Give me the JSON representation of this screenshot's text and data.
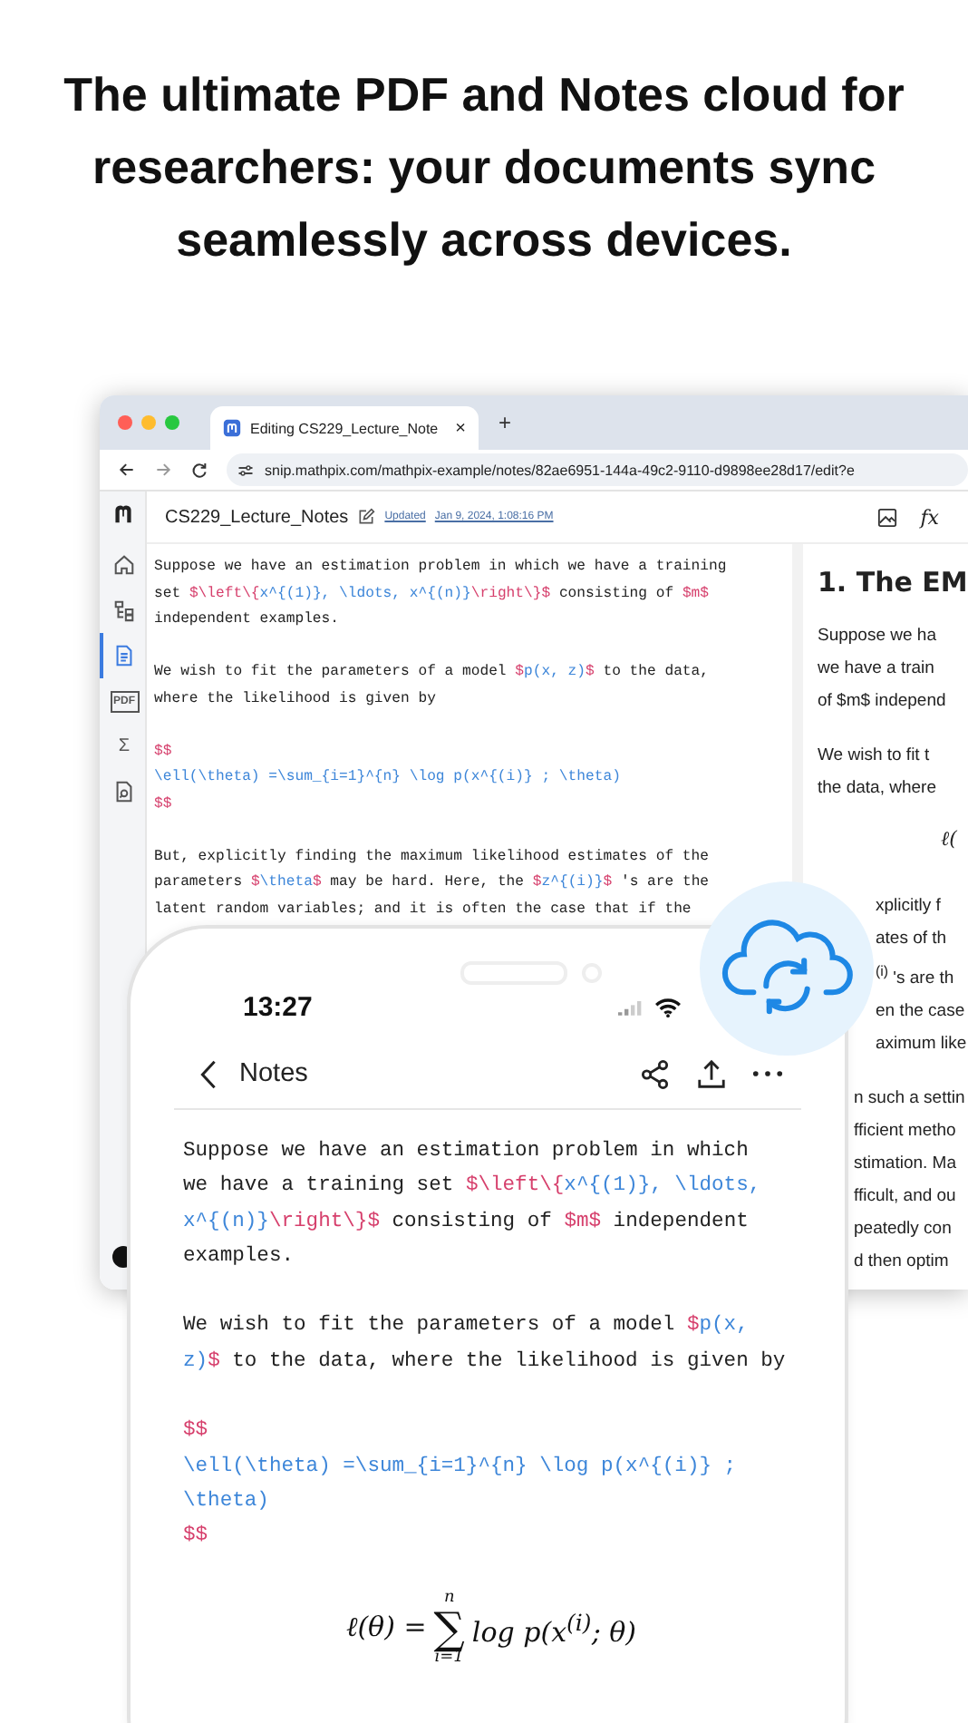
{
  "headline": "The ultimate PDF and Notes cloud for researchers: your documents sync seamlessly across devices.",
  "browser": {
    "tab_title": "Editing CS229_Lecture_Note",
    "tab_close": "×",
    "new_tab": "+",
    "url": "snip.mathpix.com/mathpix-example/notes/82ae6951-144a-49c2-9110-d9898ee28d17/edit?e",
    "note_title": "CS229_Lecture_Notes",
    "updated_label": "Updated",
    "updated_date": "Jan 9, 2024, 1:08:16 PM",
    "formula_button": "fx",
    "sidebar": [
      {
        "kind": "home",
        "selected": false
      },
      {
        "kind": "outline",
        "selected": false
      },
      {
        "kind": "document",
        "selected": true
      },
      {
        "kind": "pdf",
        "label": "PDF",
        "selected": false
      },
      {
        "kind": "sigma",
        "label": "Σ",
        "selected": false
      },
      {
        "kind": "search-doc",
        "selected": false
      }
    ],
    "editor": [
      [
        [
          {
            "text": "Suppose we have an estimation problem in which we have a training",
            "kind": "plain"
          }
        ],
        [
          {
            "text": "set ",
            "kind": "plain"
          },
          {
            "text": "$\\left\\{",
            "kind": "delim"
          },
          {
            "text": "x^{(1)}, \\ldots, x^{(n)}",
            "kind": "math"
          },
          {
            "text": "\\right\\}$",
            "kind": "delim"
          },
          {
            "text": " consisting of ",
            "kind": "plain"
          },
          {
            "text": "$m$",
            "kind": "delim"
          }
        ],
        [
          {
            "text": "independent examples.",
            "kind": "plain"
          }
        ]
      ],
      [
        [
          {
            "text": "We wish to fit the parameters of a model ",
            "kind": "plain"
          },
          {
            "text": "$",
            "kind": "delim"
          },
          {
            "text": "p(x, z)",
            "kind": "math"
          },
          {
            "text": "$",
            "kind": "delim"
          },
          {
            "text": " to the data,",
            "kind": "plain"
          }
        ],
        [
          {
            "text": "where the likelihood is given by",
            "kind": "plain"
          }
        ]
      ],
      [
        [
          {
            "text": "$$",
            "kind": "delim"
          }
        ],
        [
          {
            "text": "\\ell(\\theta) =\\sum_{i=1}^{n} \\log p(x^{(i)} ; \\theta)",
            "kind": "math"
          }
        ],
        [
          {
            "text": "$$",
            "kind": "delim"
          }
        ]
      ],
      [
        [
          {
            "text": "But, explicitly finding the maximum likelihood estimates of the",
            "kind": "plain"
          }
        ],
        [
          {
            "text": "parameters ",
            "kind": "plain"
          },
          {
            "text": "$",
            "kind": "delim"
          },
          {
            "text": "\\theta",
            "kind": "math"
          },
          {
            "text": "$",
            "kind": "delim"
          },
          {
            "text": " may be hard. Here, the ",
            "kind": "plain"
          },
          {
            "text": "$",
            "kind": "delim"
          },
          {
            "text": "z^{(i)}",
            "kind": "math"
          },
          {
            "text": "$",
            "kind": "delim"
          },
          {
            "text": " 's are the",
            "kind": "plain"
          }
        ],
        [
          {
            "text": "latent random variables; and it is often the case that if the",
            "kind": "plain"
          }
        ]
      ]
    ],
    "preview": {
      "heading": "1. The EM",
      "paragraphs": [
        [
          "Suppose we ha",
          "we have a train",
          "of $m$ independ"
        ],
        [
          "We wish to fit t",
          "the data, where"
        ]
      ],
      "formula_fragment": "ℓ(",
      "cut_paragraphs": [
        [
          "xplicitly f",
          "ates of th",
          "$^{(i)}$ 's are th",
          "en the case",
          "aximum like"
        ],
        [
          "n such a settin",
          "fficient metho",
          "stimation. Ma",
          "fficult, and ou",
          "peatedly con",
          "d then optim"
        ]
      ]
    }
  },
  "phone": {
    "time": "13:27",
    "back_label": "Notes",
    "paragraphs": [
      [
        [
          {
            "text": "Suppose we have an estimation problem in which",
            "kind": "plain"
          }
        ],
        [
          {
            "text": "we have a training set ",
            "kind": "plain"
          },
          {
            "text": "$\\left\\{",
            "kind": "delim"
          },
          {
            "text": "x^{(1)}, \\ldots,",
            "kind": "math"
          }
        ],
        [
          {
            "text": "x^{(n)}",
            "kind": "math"
          },
          {
            "text": "\\right\\}$",
            "kind": "delim"
          },
          {
            "text": " consisting of ",
            "kind": "plain"
          },
          {
            "text": "$m$",
            "kind": "delim"
          },
          {
            "text": " independent",
            "kind": "plain"
          }
        ],
        [
          {
            "text": "examples.",
            "kind": "plain"
          }
        ]
      ],
      [
        [
          {
            "text": "We wish to fit the parameters of a model ",
            "kind": "plain"
          },
          {
            "text": "$",
            "kind": "delim"
          },
          {
            "text": "p(x,",
            "kind": "math"
          }
        ],
        [
          {
            "text": "z)",
            "kind": "math"
          },
          {
            "text": "$",
            "kind": "delim"
          },
          {
            "text": " to the data, where the likelihood is given by",
            "kind": "plain"
          }
        ]
      ],
      [
        [
          {
            "text": "$$",
            "kind": "delim"
          }
        ],
        [
          {
            "text": "\\ell(\\theta) =\\sum_{i=1}^{n} \\log p(x^{(i)} ;",
            "kind": "math"
          }
        ],
        [
          {
            "text": "\\theta)",
            "kind": "math"
          }
        ],
        [
          {
            "text": "$$",
            "kind": "delim"
          }
        ]
      ]
    ],
    "formula": {
      "lhs": "ℓ(θ) =",
      "operator": "∑",
      "upper": "n",
      "lower": "i=1",
      "rhs": "log p(x$^{(i)}$; θ)"
    }
  }
}
